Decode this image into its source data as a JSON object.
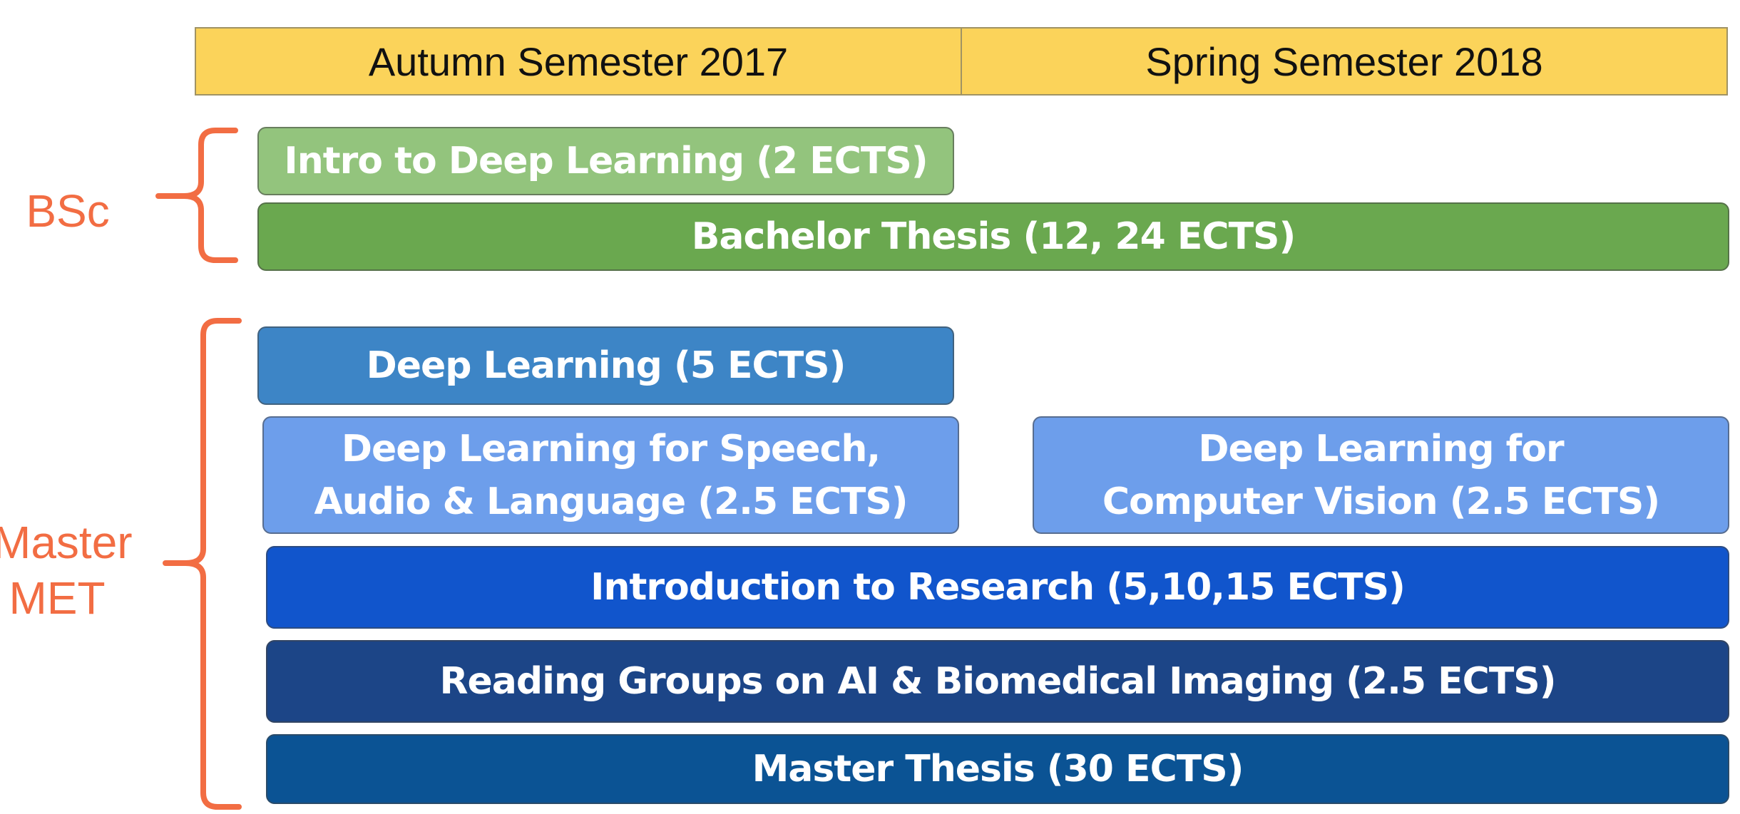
{
  "semesters": [
    {
      "label": "Autumn Semester 2017"
    },
    {
      "label": "Spring Semester 2018"
    }
  ],
  "groups": {
    "bsc": {
      "label": "BSc",
      "color": "#f26d43"
    },
    "master": {
      "label": "Master\nMET",
      "color": "#f26d43"
    }
  },
  "courses": [
    {
      "label": "Intro to Deep Learning (2 ECTS)",
      "color": "#93c47d",
      "group": "bsc",
      "semesters": [
        "Autumn Semester 2017"
      ]
    },
    {
      "label": "Bachelor Thesis (12, 24 ECTS)",
      "color": "#6aa84f",
      "group": "bsc",
      "semesters": [
        "Autumn Semester 2017",
        "Spring Semester 2018"
      ]
    },
    {
      "label": "Deep Learning (5 ECTS)",
      "color": "#3d85c6",
      "group": "master",
      "semesters": [
        "Autumn Semester 2017"
      ]
    },
    {
      "label": "Deep Learning for Speech,\nAudio & Language (2.5 ECTS)",
      "color": "#6d9eeb",
      "group": "master",
      "semesters": [
        "Autumn Semester 2017"
      ]
    },
    {
      "label": "Deep Learning for\nComputer Vision (2.5 ECTS)",
      "color": "#6d9eeb",
      "group": "master",
      "semesters": [
        "Spring Semester 2018"
      ]
    },
    {
      "label": "Introduction to Research (5,10,15 ECTS)",
      "color": "#1155cc",
      "group": "master",
      "semesters": [
        "Autumn Semester 2017",
        "Spring Semester 2018"
      ]
    },
    {
      "label": "Reading Groups on AI & Biomedical Imaging (2.5 ECTS)",
      "color": "#1c4587",
      "group": "master",
      "semesters": [
        "Autumn Semester 2017",
        "Spring Semester 2018"
      ]
    },
    {
      "label": "Master Thesis (30 ECTS)",
      "color": "#0b5394",
      "group": "master",
      "semesters": [
        "Autumn Semester 2017",
        "Spring Semester 2018"
      ]
    }
  ]
}
